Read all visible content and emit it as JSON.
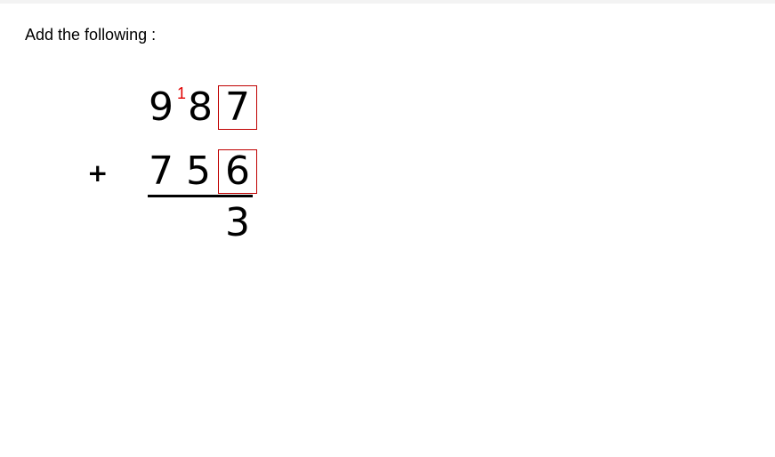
{
  "instruction": "Add the following :",
  "problem": {
    "operator": "+",
    "top_number": {
      "digits": [
        "9",
        "8",
        "7"
      ]
    },
    "bottom_number": {
      "digits": [
        "7",
        "5",
        "6"
      ]
    },
    "carry": "1",
    "result_digits": [
      "3"
    ]
  },
  "colors": {
    "highlight_box": "#c00000",
    "carry_text": "#e00000",
    "text": "#000000"
  }
}
